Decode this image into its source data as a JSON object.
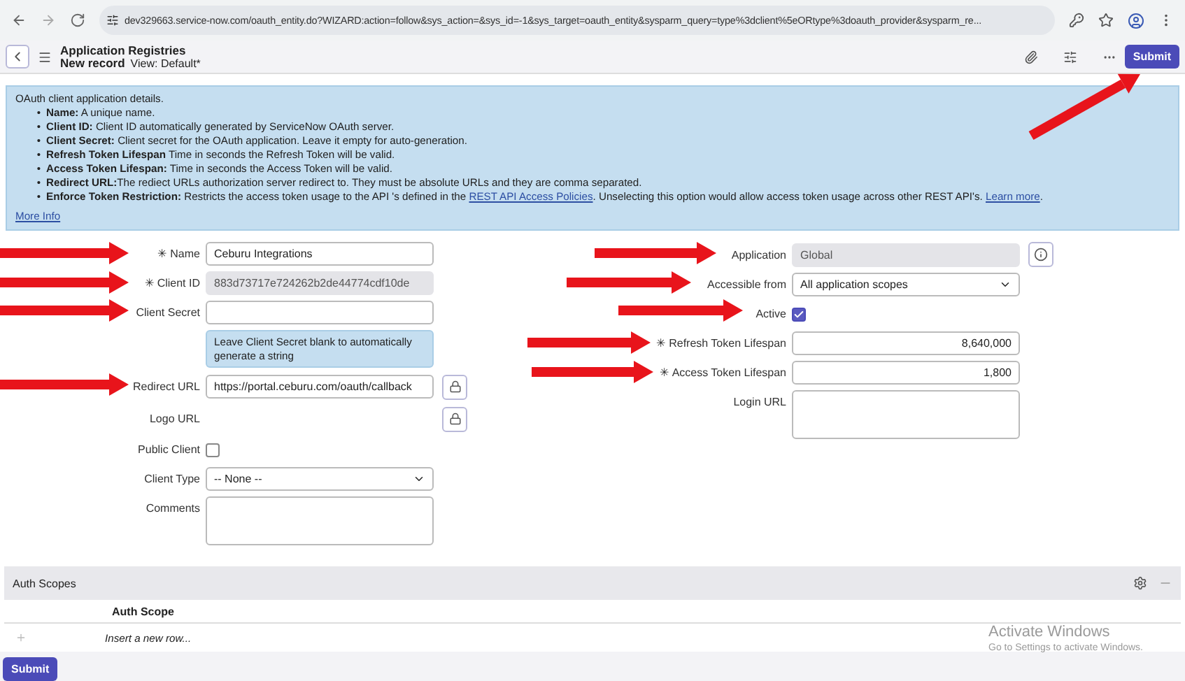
{
  "browser": {
    "url": "dev329663.service-now.com/oauth_entity.do?WIZARD:action=follow&sys_action=&sys_id=-1&sys_target=oauth_entity&sysparm_query=type%3dclient%5eORtype%3doauth_provider&sysparm_re..."
  },
  "header": {
    "title": "Application Registries",
    "subtitle": "New record",
    "view": "View: Default*",
    "submit": "Submit"
  },
  "info": {
    "intro": "OAuth client application details.",
    "items": [
      {
        "bullet": "•",
        "text": "**Name:** A unique name."
      },
      {
        "bullet": "•",
        "text": "**Client ID:** Client ID automatically generated by ServiceNow OAuth server."
      },
      {
        "bullet": "•",
        "text": "**Client Secret:** Client secret for the OAuth application. Leave it empty for auto-generation."
      },
      {
        "bullet": "•",
        "text": "**Refresh Token Lifespan** Time in seconds the Refresh Token will be valid."
      },
      {
        "bullet": "•",
        "text": "**Access Token Lifespan:** Time in seconds the Access Token will be valid."
      },
      {
        "bullet": "•",
        "text": "**Redirect URL:**The rediect URLs authorization server redirect to. They must be absolute URLs and they are comma separated."
      },
      {
        "bullet": "•",
        "text": "**Enforce Token Restriction:** Restricts the access token usage to the API 's defined in the ",
        "link1": "REST API Access Policies",
        "after_link1": ". Unselecting this option would allow access token usage across other REST API's. ",
        "link2": "Learn more",
        "after_link2": "."
      }
    ],
    "more": "More Info"
  },
  "left_fields": [
    {
      "kind": "input",
      "label": "Name",
      "required_mark": "✳",
      "value": "Ceburu Integrations",
      "readonly": false
    },
    {
      "kind": "input",
      "label": "Client ID",
      "required_mark": "✳",
      "value": "883d73717e724262b2de44774cdf10de",
      "readonly": true
    },
    {
      "kind": "input",
      "label": "Client Secret",
      "readonly": false
    },
    {
      "kind": "hint",
      "text": "Leave Client Secret blank to automatically generate a string"
    },
    {
      "kind": "url",
      "label": "Redirect URL",
      "value": "https://portal.ceburu.com/oauth/callback"
    },
    {
      "kind": "url_empty",
      "label": "Logo URL"
    },
    {
      "kind": "checkbox",
      "label": "Public Client",
      "checked": false
    },
    {
      "kind": "select",
      "label": "Client Type",
      "value": "-- None --"
    },
    {
      "kind": "textarea",
      "label": "Comments"
    }
  ],
  "right_fields": [
    {
      "kind": "input",
      "label": "Application",
      "value": "Global",
      "readonly": true
    },
    {
      "kind": "select",
      "label": "Accessible from",
      "value": "All application scopes"
    },
    {
      "kind": "checkbox",
      "label": "Active",
      "checked": true
    },
    {
      "kind": "number",
      "label": "Refresh Token Lifespan",
      "required_mark": "✳",
      "value": "8,640,000"
    },
    {
      "kind": "number",
      "label": "Access Token Lifespan",
      "required_mark": "✳",
      "value": "1,800"
    },
    {
      "kind": "textarea",
      "label": "Login URL"
    }
  ],
  "auth_scopes": {
    "title": "Auth Scopes",
    "column": "Auth Scope",
    "insert": "Insert a new row..."
  },
  "os_notice": {
    "title": "Activate Windows",
    "text": "Go to Settings to activate Windows."
  },
  "footer": {
    "submit": "Submit"
  }
}
